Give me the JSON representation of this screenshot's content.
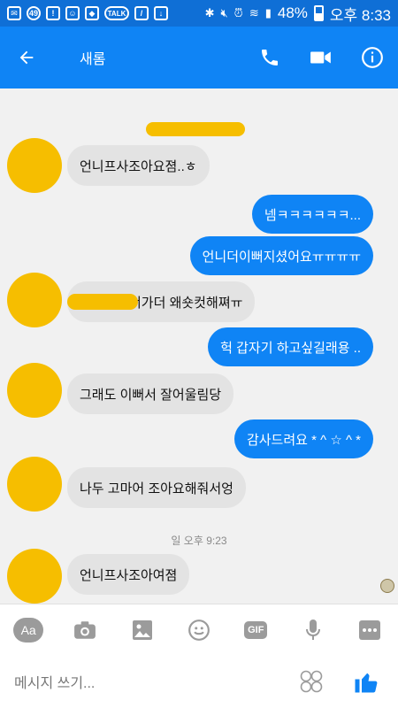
{
  "status_bar": {
    "notification_count": "49",
    "battery_level": "48%",
    "time": "오후 8:33",
    "icons": [
      "mail-icon",
      "alert-icon",
      "face-icon",
      "pill-icon",
      "talk-icon",
      "broom-icon",
      "download-icon",
      "bluetooth-icon",
      "mute-icon",
      "alarm-icon",
      "wifi-icon",
      "signal-icon",
      "battery-icon"
    ]
  },
  "header": {
    "title": "새롬",
    "icons": [
      "back-arrow-icon",
      "phone-icon",
      "video-icon",
      "info-icon"
    ]
  },
  "messages": [
    {
      "side": "in",
      "text": "언니프사조아요졈..ㅎ"
    },
    {
      "side": "out",
      "text": "넴ㅋㅋㅋㅋㅋㅋ..."
    },
    {
      "side": "out",
      "text": "언니더이뻐지셨어요ㅠㅠㅠㅠ"
    },
    {
      "side": "in",
      "text": "너가더 왜숏컷해쪄ㅠ"
    },
    {
      "side": "out",
      "text": "헉 갑자기 하고싶길래용 .."
    },
    {
      "side": "in",
      "text": "그래도 이뻐서 잘어울림당"
    },
    {
      "side": "out",
      "text": "감사드려요 * ^ ☆ ^ *"
    },
    {
      "side": "in",
      "text": "나두 고마어 조아요해줘서엉"
    },
    {
      "side": "in",
      "text": "언니프사조아여졈"
    }
  ],
  "timestamp": "일 오후 9:23",
  "toolbar": {
    "items": [
      "text-format-icon",
      "camera-icon",
      "image-icon",
      "emoji-icon",
      "gif-icon",
      "microphone-icon",
      "more-icon"
    ],
    "aa_label": "Aa",
    "gif_label": "GIF"
  },
  "composer": {
    "placeholder": "메시지 쓰기...",
    "icons": [
      "stickers-icon",
      "thumbs-up-icon"
    ]
  },
  "colors": {
    "statusbar": "#0f6fd6",
    "header": "#0f84f5",
    "outgoing_bubble": "#0f84f5",
    "incoming_bubble": "#e3e3e3",
    "redaction": "#f6be00"
  }
}
